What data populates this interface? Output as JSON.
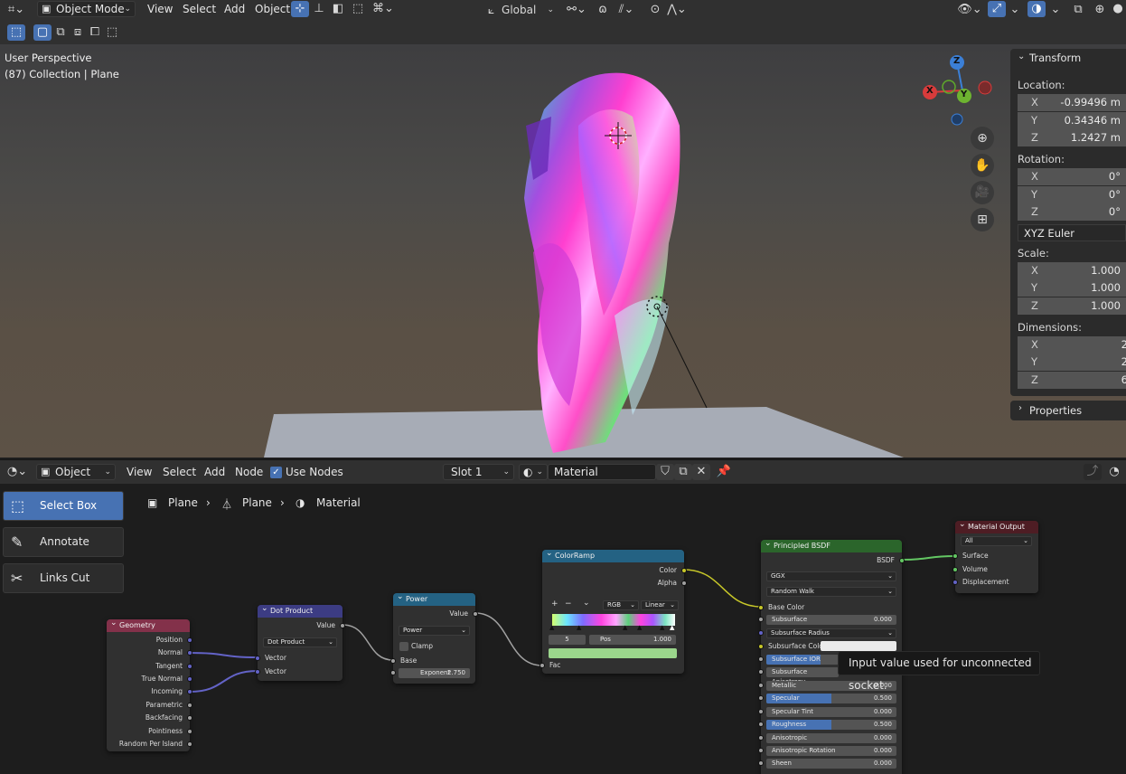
{
  "header": {
    "mode": "Object Mode",
    "menus": [
      "View",
      "Select",
      "Add",
      "Object"
    ],
    "orientation": "Global"
  },
  "viewport": {
    "perspective": "User Perspective",
    "collection": "(87) Collection | Plane",
    "gizmo": {
      "z": "Z",
      "x": "X",
      "y": "Y"
    }
  },
  "transform": {
    "title": "Transform",
    "location_label": "Location:",
    "location": {
      "x": "-0.99496 m",
      "y": "0.34346 m",
      "z": "1.2427 m"
    },
    "rotation_label": "Rotation:",
    "rotation": {
      "x": "0°",
      "y": "0°",
      "z": "0°"
    },
    "rotation_mode": "XYZ Euler",
    "scale_label": "Scale:",
    "scale": {
      "x": "1.000",
      "y": "1.000",
      "z": "1.000"
    },
    "dimensions_label": "Dimensions:",
    "dimensions": {
      "x": "2",
      "y": "2",
      "z": "6"
    },
    "axis_x": "X",
    "axis_y": "Y",
    "axis_z": "Z",
    "properties_label": "Properties"
  },
  "node_header": {
    "editor": "Object",
    "menus": [
      "View",
      "Select",
      "Add",
      "Node"
    ],
    "use_nodes": "Use Nodes",
    "slot": "Slot 1",
    "material": "Material"
  },
  "tools": [
    "Select Box",
    "Annotate",
    "Links Cut"
  ],
  "breadcrumb": [
    "Plane",
    "Plane",
    "Material"
  ],
  "nodes": {
    "geometry": {
      "title": "Geometry",
      "outputs": [
        "Position",
        "Normal",
        "Tangent",
        "True Normal",
        "Incoming",
        "Parametric",
        "Backfacing",
        "Pointiness",
        "Random Per Island"
      ]
    },
    "dot": {
      "title": "Dot Product",
      "output": "Value",
      "operation": "Dot Product",
      "inputs": [
        "Vector",
        "Vector"
      ]
    },
    "power": {
      "title": "Power",
      "output": "Value",
      "operation": "Power",
      "clamp": "Clamp",
      "base": "Base",
      "exponent_label": "Exponent",
      "exponent_value": "2.750"
    },
    "colorramp": {
      "title": "ColorRamp",
      "outputs": [
        "Color",
        "Alpha"
      ],
      "plus": "+",
      "minus": "−",
      "color_mode": "RGB",
      "interpolation": "Linear",
      "index": "5",
      "pos_label": "Pos",
      "pos_value": "1.000",
      "fac": "Fac",
      "selected_color": "#9bd68c"
    },
    "principled": {
      "title": "Principled BSDF",
      "output": "BSDF",
      "distribution": "GGX",
      "subsurface_method": "Random Walk",
      "base_color": "Base Color",
      "subsurface": {
        "label": "Subsurface",
        "value": "0.000"
      },
      "subsurface_radius": "Subsurface Radius",
      "subsurface_color": "Subsurface Color",
      "subsurface_ior": "Subsurface IOR",
      "subsurface_anisotropy": "Subsurface Anisotropy",
      "params": [
        {
          "label": "Metallic",
          "value": "0.000",
          "fill": 0
        },
        {
          "label": "Specular",
          "value": "0.500",
          "fill": 0.5
        },
        {
          "label": "Specular Tint",
          "value": "0.000",
          "fill": 0
        },
        {
          "label": "Roughness",
          "value": "0.500",
          "fill": 0.5
        },
        {
          "label": "Anisotropic",
          "value": "0.000",
          "fill": 0
        },
        {
          "label": "Anisotropic Rotation",
          "value": "0.000",
          "fill": 0
        },
        {
          "label": "Sheen",
          "value": "0.000",
          "fill": 0
        }
      ]
    },
    "output": {
      "title": "Material Output",
      "target": "All",
      "inputs": [
        "Surface",
        "Volume",
        "Displacement"
      ]
    }
  },
  "tooltip": "Input value used for unconnected socket.",
  "colors": {
    "accent": "#4772b3",
    "geometry_header": "#83314a",
    "vector_header": "#3c3c83",
    "converter_header": "#246283",
    "shader_header": "#2b652b",
    "output_header": "#4e1d24"
  }
}
